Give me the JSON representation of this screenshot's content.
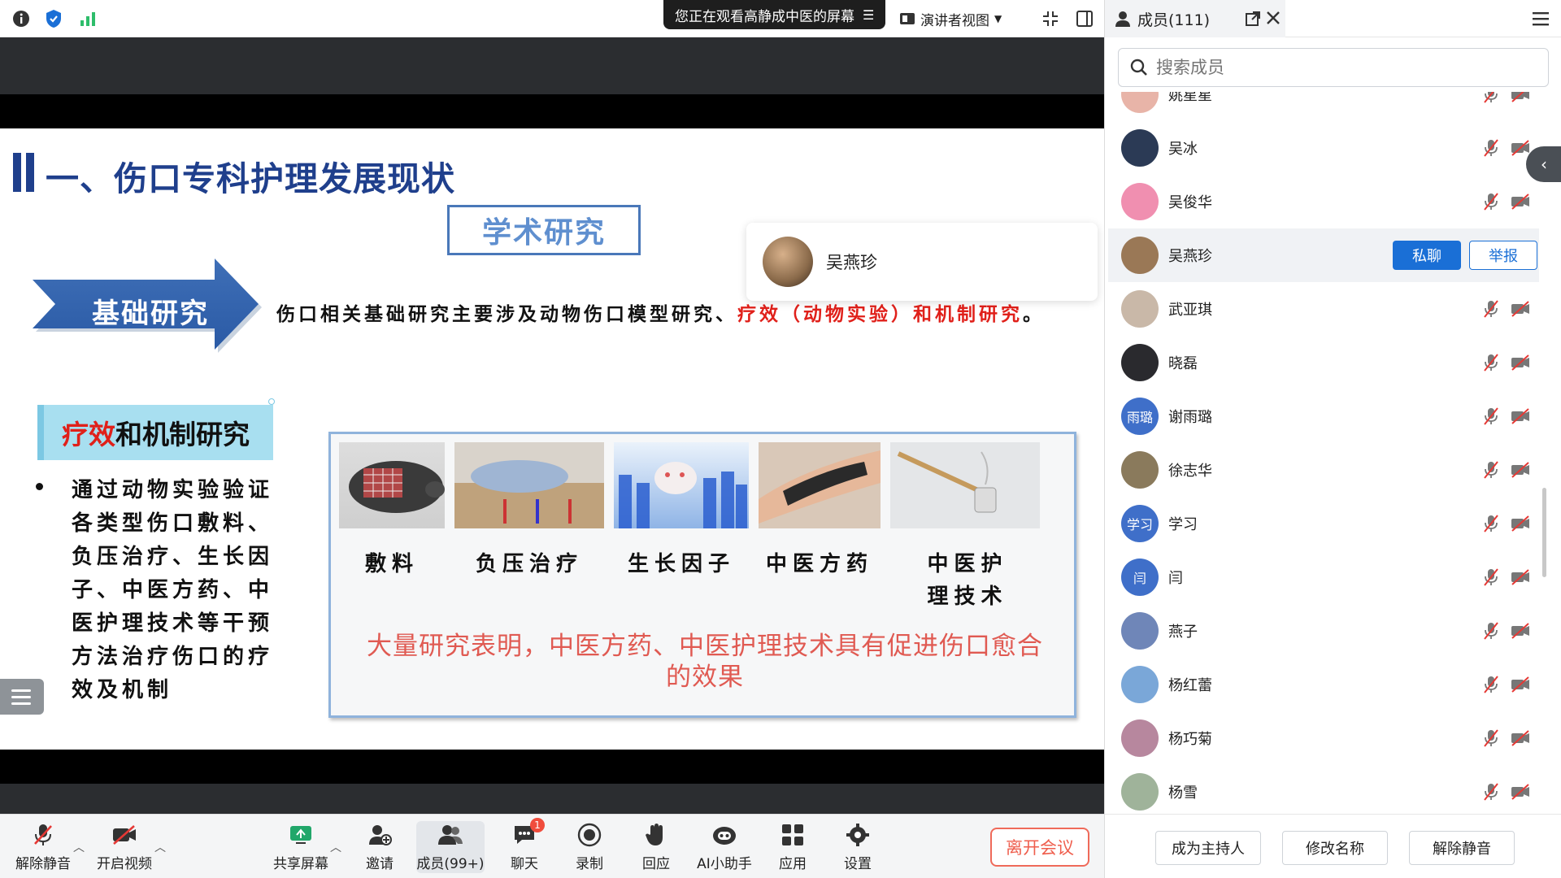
{
  "topbar": {
    "share_banner": "您正在观看高静成中医的屏幕",
    "view_mode": "演讲者视图"
  },
  "slide": {
    "title": "一、伤口专科护理发展现状",
    "academic_box": "学术研究",
    "arrow_label": "基础研究",
    "basic_text_black": "伤口相关基础研究主要涉及动物伤口模型研究、",
    "basic_text_red": "疗效（动物实验）和机制研究",
    "basic_text_end": "。",
    "sub_tab_red": "疗效",
    "sub_tab_black": "和机制研究",
    "bullet_text": "通过动物实验验证各类型伤口敷料、负压治疗、生长因子、中医方药、中医护理技术等干预方法治疗伤口的疗效及机制",
    "captions": [
      "敷料",
      "负压治疗",
      "生长因子",
      "中医方药",
      "中医护理技术"
    ],
    "panel_note": "大量研究表明，中医方药、中医护理技术具有促进伤口愈合的效果"
  },
  "hover_card": {
    "name": "吴燕珍"
  },
  "toolbar": {
    "unmute": "解除静音",
    "start_video": "开启视频",
    "share_screen": "共享屏幕",
    "invite": "邀请",
    "members": "成员(99+)",
    "chat": "聊天",
    "chat_badge": "1",
    "record": "录制",
    "react": "回应",
    "ai_assistant": "AI小助手",
    "apps": "应用",
    "settings": "设置",
    "leave": "离开会议"
  },
  "members_panel": {
    "tab_label": "成员(111)",
    "search_placeholder": "搜索成员",
    "dm_label": "私聊",
    "report_label": "举报",
    "members": [
      {
        "name": "姚星星",
        "avatar_text": "",
        "avatar_color": "#e8b4a8"
      },
      {
        "name": "吴冰",
        "avatar_text": "",
        "avatar_color": "#2b3a55"
      },
      {
        "name": "吴俊华",
        "avatar_text": "",
        "avatar_color": "#f08fb0"
      },
      {
        "name": "吴燕珍",
        "avatar_text": "",
        "avatar_color": "#9a7856"
      },
      {
        "name": "武亚琪",
        "avatar_text": "",
        "avatar_color": "#c9b8a8"
      },
      {
        "name": "晓磊",
        "avatar_text": "",
        "avatar_color": "#2a2a2e"
      },
      {
        "name": "谢雨璐",
        "avatar_text": "雨璐",
        "avatar_color": "#3f6fc9"
      },
      {
        "name": "徐志华",
        "avatar_text": "",
        "avatar_color": "#8a7a5c"
      },
      {
        "name": "学习",
        "avatar_text": "学习",
        "avatar_color": "#3f6fc9"
      },
      {
        "name": "闫",
        "avatar_text": "闫",
        "avatar_color": "#3f6fc9"
      },
      {
        "name": "燕子",
        "avatar_text": "",
        "avatar_color": "#6f86b8"
      },
      {
        "name": "杨红蕾",
        "avatar_text": "",
        "avatar_color": "#7aa7d8"
      },
      {
        "name": "杨巧菊",
        "avatar_text": "",
        "avatar_color": "#b7879e"
      },
      {
        "name": "杨雪",
        "avatar_text": "",
        "avatar_color": "#9fb39a"
      }
    ],
    "footer": {
      "make_host": "成为主持人",
      "rename": "修改名称",
      "unmute": "解除静音"
    }
  },
  "colors": {
    "accent_blue": "#1a6fd6",
    "slide_title_blue": "#1f3f8c",
    "emphasis_red": "#e0201a",
    "leave_red": "#ef5e4d"
  }
}
